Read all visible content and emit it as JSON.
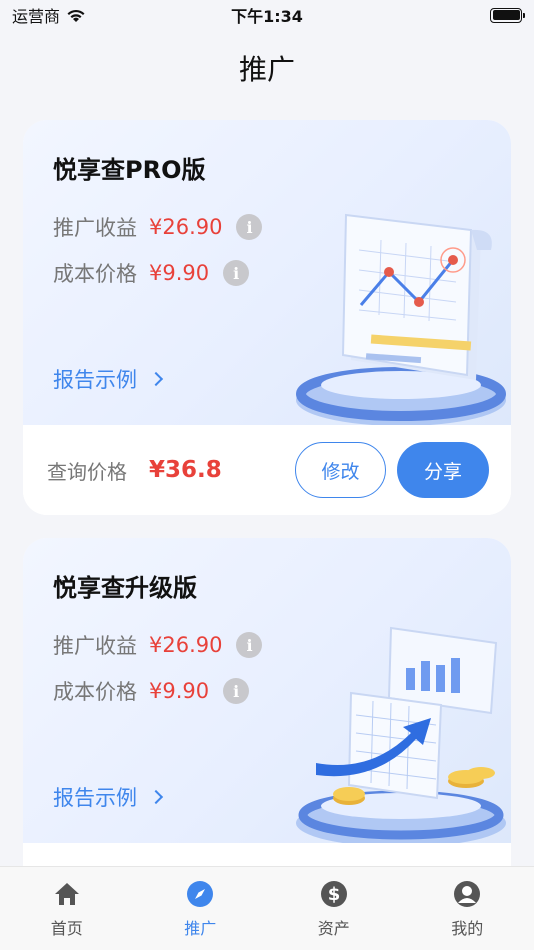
{
  "status_bar": {
    "carrier": "运营商",
    "time": "下午1:34"
  },
  "header": {
    "title": "推广"
  },
  "cards": [
    {
      "title": "悦享查PRO版",
      "income_label": "推广收益",
      "income_value": "¥26.90",
      "cost_label": "成本价格",
      "cost_value": "¥9.90",
      "report_link": "报告示例",
      "query_label": "查询价格",
      "query_price": "¥36.8",
      "edit_label": "修改",
      "share_label": "分享"
    },
    {
      "title": "悦享查升级版",
      "income_label": "推广收益",
      "income_value": "¥26.90",
      "cost_label": "成本价格",
      "cost_value": "¥9.90",
      "report_link": "报告示例"
    }
  ],
  "tabs": [
    {
      "label": "首页",
      "icon": "home-icon"
    },
    {
      "label": "推广",
      "icon": "compass-icon"
    },
    {
      "label": "资产",
      "icon": "dollar-icon"
    },
    {
      "label": "我的",
      "icon": "user-icon"
    }
  ],
  "colors": {
    "accent": "#3f86ec",
    "price": "#e8413a"
  }
}
